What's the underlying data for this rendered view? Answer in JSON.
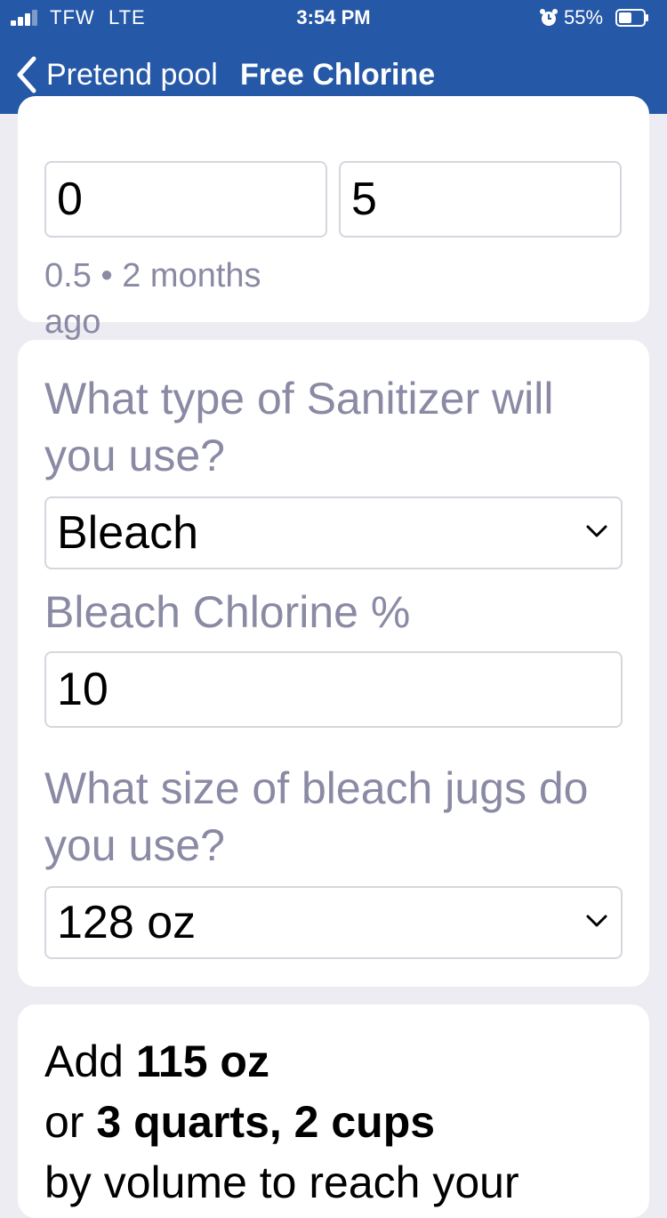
{
  "status_bar": {
    "carrier": "TFW",
    "network": "LTE",
    "time": "3:54 PM",
    "battery_percent": "55%",
    "signal_bars": 3,
    "battery_level": 0.55
  },
  "nav": {
    "back_label": "Pretend pool",
    "title": "Free Chlorine"
  },
  "range_card": {
    "min_value": "0",
    "max_value": "5",
    "last_reading": "0.5 • 2 months ago"
  },
  "sanitizer_card": {
    "sanitizer_question": "What type of Sanitizer will you use?",
    "sanitizer_selected": "Bleach",
    "chlorine_label": "Bleach Chlorine %",
    "chlorine_value": "10",
    "jug_question": "What size of bleach jugs do you use?",
    "jug_selected": "128 oz"
  },
  "result_card": {
    "add_prefix": "Add",
    "amount": "115 oz",
    "or_prefix": "or",
    "alt_amount": "3 quarts, 2 cups",
    "trailing_text": "by volume to reach your"
  },
  "colors": {
    "nav_background": "#2558a7",
    "page_background": "#ececf2",
    "label_gray": "#8a8aa4"
  }
}
